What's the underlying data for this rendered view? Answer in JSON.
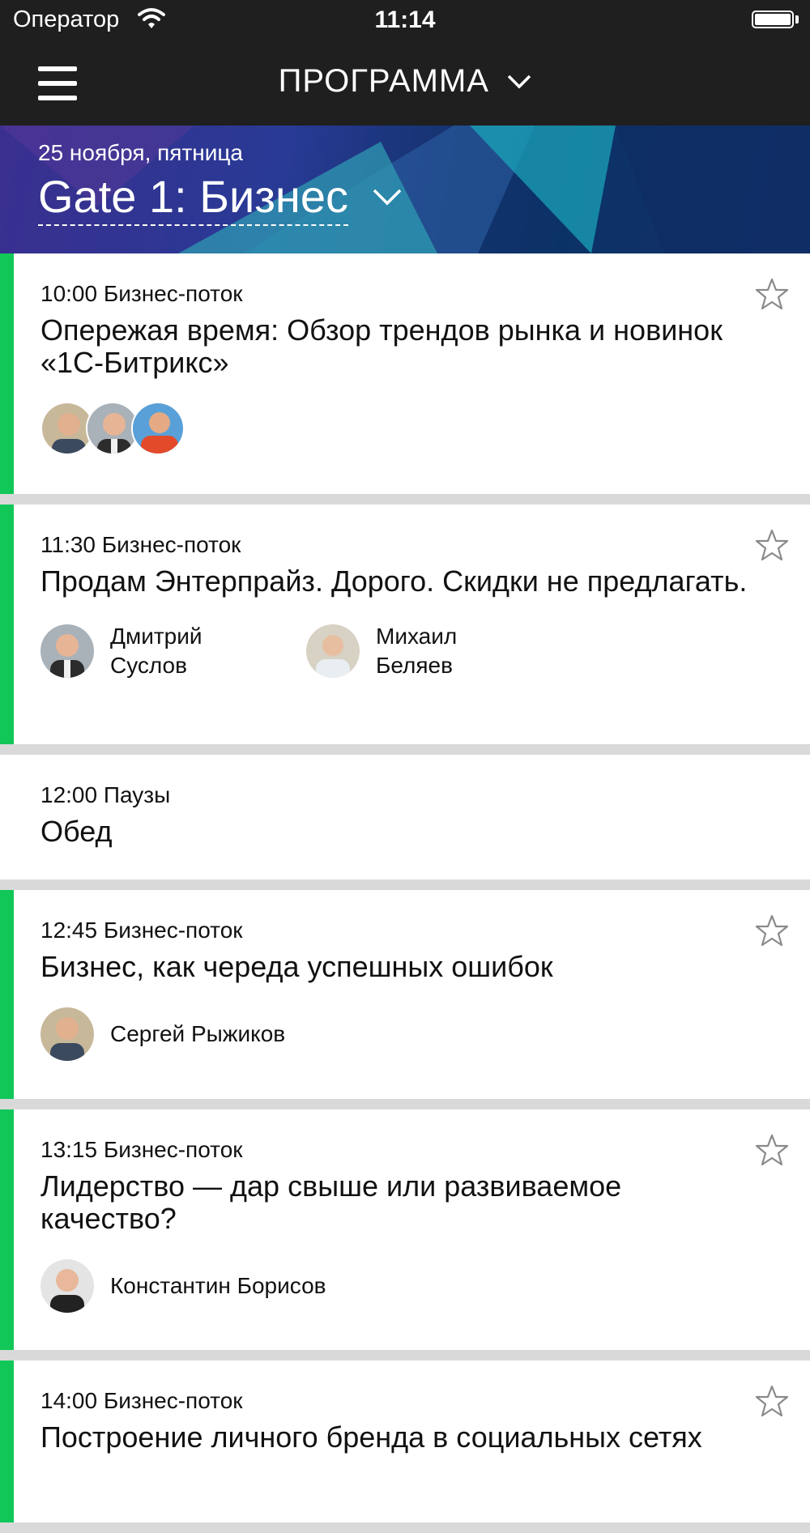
{
  "status_bar": {
    "carrier": "Оператор",
    "time": "11:14"
  },
  "nav": {
    "title": "ПРОГРАММА"
  },
  "hero": {
    "date": "25 ноября, пятница",
    "track": "Gate 1: Бизнес"
  },
  "sessions": [
    {
      "meta": "10:00 Бизнес-поток",
      "title": "Опережая время: Обзор трендов рынка и новинок «1С-Битрикс»"
    },
    {
      "meta": "11:30 Бизнес-поток",
      "title": "Продам Энтерпрайз. Дорого. Скидки не предлагать.",
      "speakers": [
        {
          "name": "Дмитрий Суслов"
        },
        {
          "name": "Михаил Беляев"
        }
      ]
    },
    {
      "meta": "12:00 Паузы",
      "title": "Обед"
    },
    {
      "meta": "12:45 Бизнес-поток",
      "title": "Бизнес, как череда успешных ошибок",
      "speakers": [
        {
          "name": "Сергей Рыжиков"
        }
      ]
    },
    {
      "meta": "13:15 Бизнес-поток",
      "title": "Лидерство — дар свыше или развиваемое качество?",
      "speakers": [
        {
          "name": "Константин Борисов"
        }
      ]
    },
    {
      "meta": "14:00 Бизнес-поток",
      "title": "Построение личного бренда в социальных сетях"
    }
  ],
  "colors": {
    "accent": "#11c758",
    "bar": "#1f1f1f"
  }
}
